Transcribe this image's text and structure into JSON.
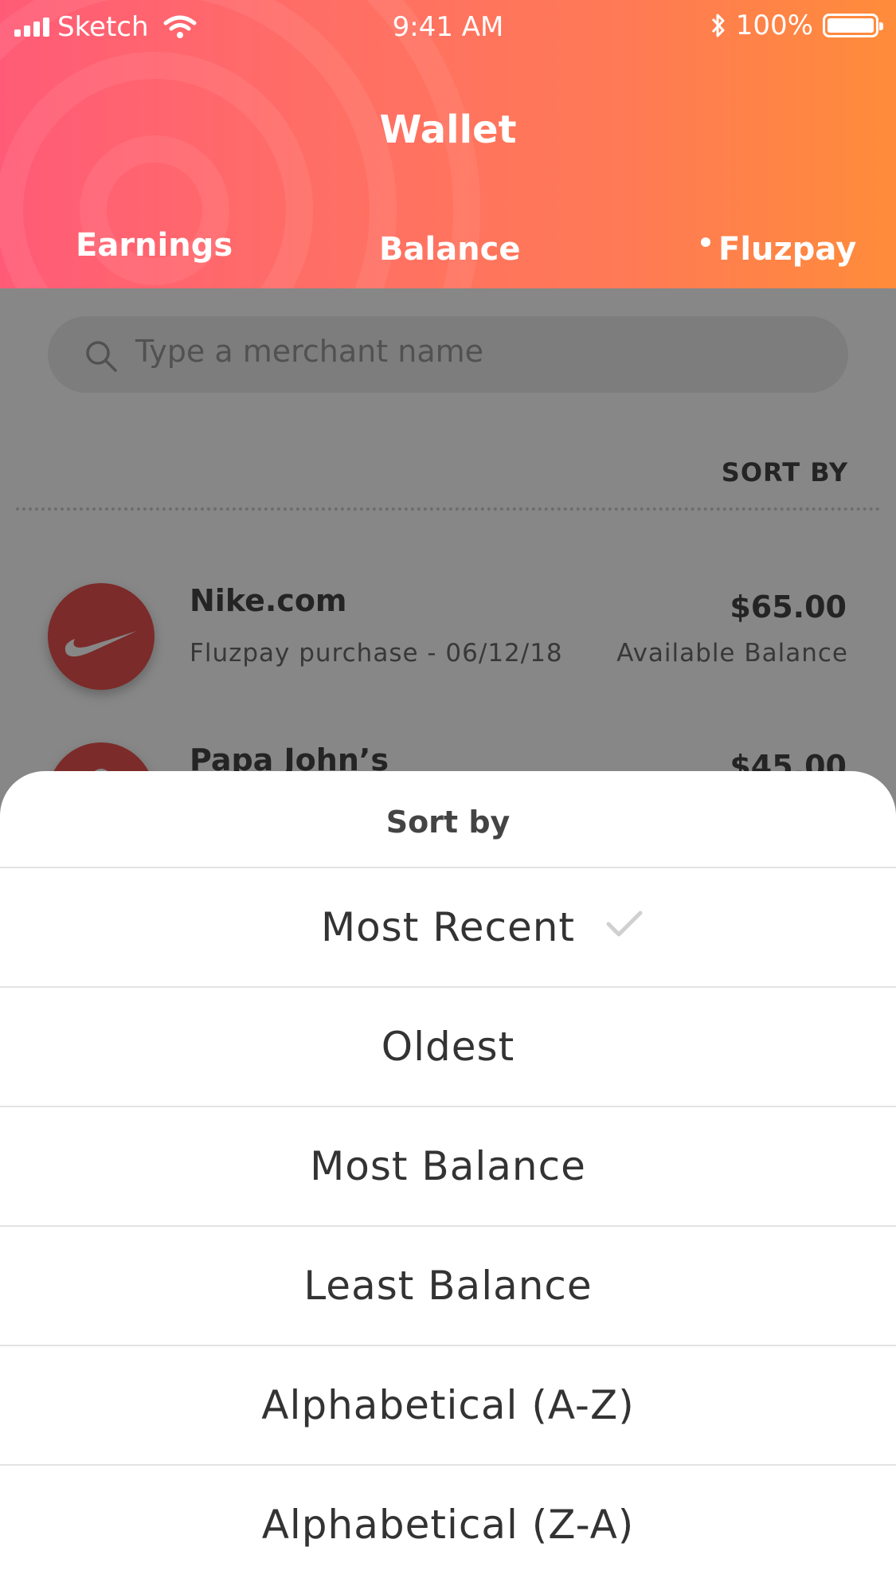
{
  "status_bar": {
    "carrier": "Sketch",
    "time": "9:41 AM",
    "battery": "100%"
  },
  "header": {
    "title": "Wallet",
    "tabs": [
      {
        "label": "Earnings",
        "selected": false
      },
      {
        "label": "Balance",
        "selected": false
      },
      {
        "label": "Fluzpay",
        "selected": true
      }
    ]
  },
  "search": {
    "placeholder": "Type a merchant name"
  },
  "sort": {
    "label": "SORT BY"
  },
  "merchants": [
    {
      "name": "Nike.com",
      "subtitle": "Fluzpay purchase - 06/12/18",
      "amount": "$65.00",
      "balance_label": "Available Balance",
      "logo": "nike-swoosh-icon"
    },
    {
      "name": "Papa John’s",
      "amount": "$45.00",
      "logo": "papa-johns-icon"
    }
  ],
  "sheet": {
    "title": "Sort by",
    "options": [
      {
        "label": "Most Recent",
        "selected": true
      },
      {
        "label": "Oldest",
        "selected": false
      },
      {
        "label": "Most Balance",
        "selected": false
      },
      {
        "label": "Least Balance",
        "selected": false
      },
      {
        "label": "Alphabetical (A-Z)",
        "selected": false
      },
      {
        "label": "Alphabetical (Z-A)",
        "selected": false
      }
    ]
  },
  "colors": {
    "gradient_start": "#ff5b77",
    "gradient_end": "#ff8c3a",
    "merchant_logo": "#e8524f",
    "overlay": "rgba(0,0,0,0.47)"
  }
}
